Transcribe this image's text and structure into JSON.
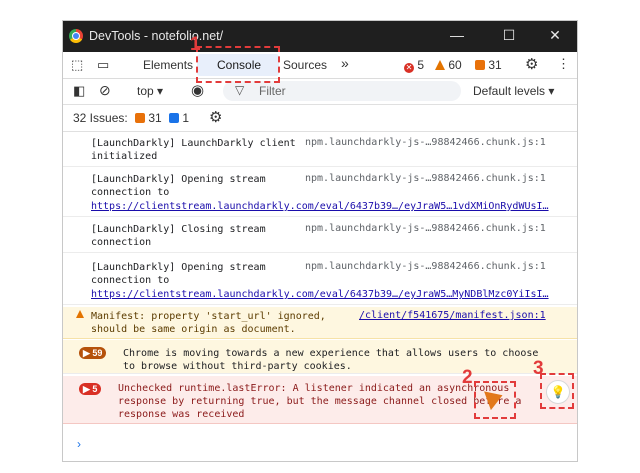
{
  "window": {
    "title": "DevTools - notefolio.net/",
    "controls": [
      "—",
      "☐",
      "✕"
    ]
  },
  "tabs": {
    "items": [
      "Elements",
      "Console",
      "Sources"
    ],
    "more": "»",
    "active": "Console",
    "error_count": "5",
    "warning_count": "60",
    "issue_count": "31"
  },
  "console_toolbar": {
    "context": "top",
    "filter_placeholder": "Filter",
    "levels": "Default levels"
  },
  "issues_bar": {
    "label": "32 Issues:",
    "issue_count": "31",
    "info_count": "1"
  },
  "logs": [
    {
      "text": "[LaunchDarkly] LaunchDarkly client\ninitialized",
      "source": "npm.launchdarkly-js-…98842466.chunk.js:1"
    },
    {
      "text": "[LaunchDarkly] Opening stream\nconnection to",
      "source": "npm.launchdarkly-js-…98842466.chunk.js:1",
      "url": "https://clientstream.launchdarkly.com/eval/6437b39…/eyJraW5…1vdXMiOnRydWUsI…"
    },
    {
      "text": "[LaunchDarkly] Closing stream\nconnection",
      "source": "npm.launchdarkly-js-…98842466.chunk.js:1"
    },
    {
      "text": "[LaunchDarkly] Opening stream\nconnection to",
      "source": "npm.launchdarkly-js-…98842466.chunk.js:1",
      "url": "https://clientstream.launchdarkly.com/eval/6437b39…/eyJraW5…MyNDBlMzc0YiIsI…"
    },
    {
      "text": "Manifest: property 'start_url' ignored,\nshould be same origin as document.",
      "source": "/client/f541675/manifest.json:1"
    },
    {
      "count": "59",
      "text": "Chrome is moving towards a new experience that allows users to choose\nto browse without third-party cookies."
    },
    {
      "count": "5",
      "text": "Unchecked runtime.lastError: A listener indicated an asynchronous\nresponse by returning true, but the message channel closed before a\nresponse was received"
    }
  ],
  "prompt": "›",
  "annotations": [
    "1",
    "2",
    "3"
  ],
  "colors": {
    "title_bar": "#1f1f1f",
    "active_tab": "#e8effb",
    "annotation": "#e23b3b",
    "warning_bg": "#fef7e0",
    "error_bg": "#fdecea"
  }
}
